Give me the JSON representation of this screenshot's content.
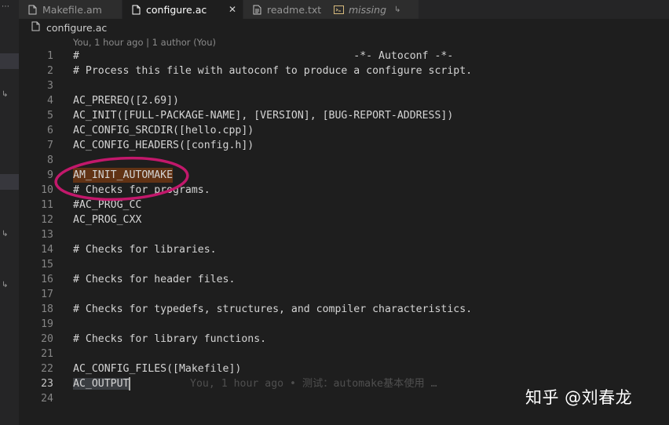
{
  "tabs": [
    {
      "name": "tab-makefile-am",
      "label": "Makefile.am",
      "icon": "file-icon",
      "active": false
    },
    {
      "name": "tab-configure-ac",
      "label": "configure.ac",
      "icon": "file-icon",
      "active": true,
      "close": "✕"
    },
    {
      "name": "tab-readme",
      "label": "readme.txt",
      "icon": "text-file-icon",
      "active": false
    },
    {
      "name": "tab-missing",
      "label": "missing",
      "icon": "terminal-file-icon",
      "active": false,
      "decoration": "↳"
    }
  ],
  "breadcrumb": {
    "file": "configure.ac"
  },
  "codelens": "You, 1 hour ago | 1 author (You)",
  "lines": [
    {
      "n": "1",
      "text": "#                                            -*- Autoconf -*-"
    },
    {
      "n": "2",
      "text": "# Process this file with autoconf to produce a configure script."
    },
    {
      "n": "3",
      "text": ""
    },
    {
      "n": "4",
      "text": "AC_PREREQ([2.69])"
    },
    {
      "n": "5",
      "text": "AC_INIT([FULL-PACKAGE-NAME], [VERSION], [BUG-REPORT-ADDRESS])"
    },
    {
      "n": "6",
      "text": "AC_CONFIG_SRCDIR([hello.cpp])"
    },
    {
      "n": "7",
      "text": "AC_CONFIG_HEADERS([config.h])"
    },
    {
      "n": "8",
      "text": ""
    },
    {
      "n": "9",
      "text": "AM_INIT_AUTOMAKE"
    },
    {
      "n": "10",
      "text": "# Checks for programs."
    },
    {
      "n": "11",
      "text": "#AC_PROG_CC"
    },
    {
      "n": "12",
      "text": "AC_PROG_CXX"
    },
    {
      "n": "13",
      "text": ""
    },
    {
      "n": "14",
      "text": "# Checks for libraries."
    },
    {
      "n": "15",
      "text": ""
    },
    {
      "n": "16",
      "text": "# Checks for header files."
    },
    {
      "n": "17",
      "text": ""
    },
    {
      "n": "18",
      "text": "# Checks for typedefs, structures, and compiler characteristics."
    },
    {
      "n": "19",
      "text": ""
    },
    {
      "n": "20",
      "text": "# Checks for library functions."
    },
    {
      "n": "21",
      "text": ""
    },
    {
      "n": "22",
      "text": "AC_CONFIG_FILES([Makefile])"
    },
    {
      "n": "23",
      "text": "AC_OUTPUT"
    },
    {
      "n": "24",
      "text": ""
    }
  ],
  "blame_inline": "You, 1 hour ago • 测试：automake基本使用 …",
  "watermark": "知乎 @刘春龙",
  "colors": {
    "highlight": "#613214",
    "annotation_circle": "#c2186b",
    "background": "#1e1e1e"
  }
}
